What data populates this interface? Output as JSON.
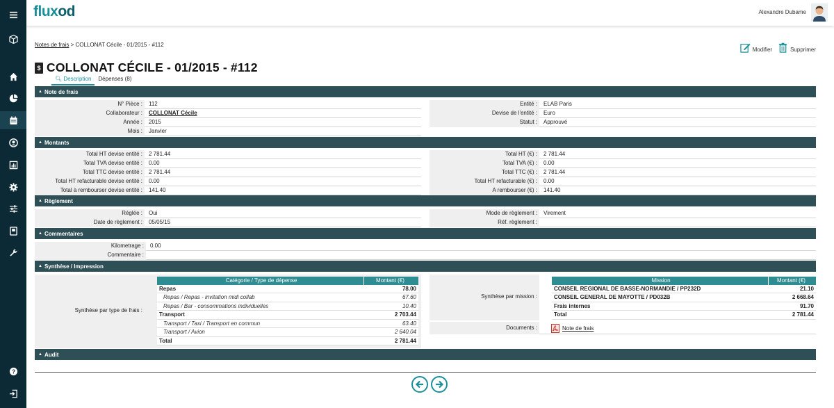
{
  "app": {
    "logo_a": "flux",
    "logo_b": "od",
    "user_name": "Alexandre Dubame"
  },
  "breadcrumb": {
    "link": "Notes de frais",
    "sep": " > ",
    "current": "COLLONAT Cécile - 01/2015 - #112"
  },
  "actions": {
    "edit": "Modifier",
    "delete": "Supprimer"
  },
  "title": "COLLONAT CÉCILE - 01/2015 - #112",
  "tabs": [
    {
      "label": "Description"
    },
    {
      "label": "Dépenses (8)"
    }
  ],
  "sections": {
    "note": "Note de frais",
    "montants": "Montants",
    "reglement": "Règlement",
    "commentaires": "Commentaires",
    "synthese": "Synthèse / Impression",
    "audit": "Audit"
  },
  "note": {
    "left": [
      {
        "label": "N° Pièce :",
        "value": "112"
      },
      {
        "label": "Collaborateur :",
        "value": "COLLONAT Cécile"
      },
      {
        "label": "Année :",
        "value": "2015"
      },
      {
        "label": "Mois :",
        "value": "Janvier"
      }
    ],
    "right": [
      {
        "label": "Entité :",
        "value": "ELAB Paris"
      },
      {
        "label": "Devise de l'entité :",
        "value": "Euro"
      },
      {
        "label": "Statut :",
        "value": "Approuvé"
      }
    ]
  },
  "montants": {
    "left": [
      {
        "label": "Total HT devise entité :",
        "value": "2 781.44"
      },
      {
        "label": "Total TVA devise entité :",
        "value": "0.00"
      },
      {
        "label": "Total TTC devise entité :",
        "value": "2 781.44"
      },
      {
        "label": "Total HT refacturable devise entité :",
        "value": "0.00"
      },
      {
        "label": "Total à rembourser devise entité :",
        "value": "141.40"
      }
    ],
    "right": [
      {
        "label": "Total HT (€) :",
        "value": "2 781.44"
      },
      {
        "label": "Total TVA (€) :",
        "value": "0.00"
      },
      {
        "label": "Total TTC (€) :",
        "value": "2 781.44"
      },
      {
        "label": "Total HT refacturable (€) :",
        "value": "0.00"
      },
      {
        "label": "A rembourser (€) :",
        "value": "141.40"
      }
    ]
  },
  "reglement": {
    "left": [
      {
        "label": "Réglée :",
        "value": "Oui"
      },
      {
        "label": "Date de règlement :",
        "value": "05/05/15"
      }
    ],
    "right": [
      {
        "label": "Mode de règlement :",
        "value": "Virement"
      },
      {
        "label": "Réf. règlement :",
        "value": ""
      }
    ]
  },
  "commentaires": [
    {
      "label": "Kilometrage :",
      "value": "0.00"
    },
    {
      "label": "Commentaire :",
      "value": ""
    }
  ],
  "synthese": {
    "type_label": "Synthèse par type de frais :",
    "mission_label": "Synthèse par mission :",
    "documents_label": "Documents :",
    "document_link": "Note de frais",
    "type_table": {
      "headers": [
        "Catégorie / Type de dépense",
        "Montant (€)"
      ],
      "rows": [
        {
          "name": "Repas",
          "amount": "78.00",
          "style": "b"
        },
        {
          "name": "Repas / Repas - invitation midi collab",
          "amount": "67.60",
          "style": "i"
        },
        {
          "name": "Repas / Bar - consommations individuelles",
          "amount": "10.40",
          "style": "i"
        },
        {
          "name": "Transport",
          "amount": "2 703.44",
          "style": "b"
        },
        {
          "name": "Transport / Taxi / Transport en commun",
          "amount": "63.40",
          "style": "i"
        },
        {
          "name": "Transport / Avion",
          "amount": "2 640.04",
          "style": "i"
        },
        {
          "name": "Total",
          "amount": "2 781.44",
          "style": "b"
        }
      ]
    },
    "mission_table": {
      "headers": [
        "Mission",
        "Montant (€)"
      ],
      "rows": [
        {
          "name": "CONSEIL REGIONAL DE BASSE-NORMANDIE / PP232D",
          "amount": "21.10",
          "style": "b"
        },
        {
          "name": "CONSEIL GENERAL DE MAYOTTE / PD032B",
          "amount": "2 668.64",
          "style": "b"
        },
        {
          "name": "Frais internes",
          "amount": "91.70",
          "style": "b"
        },
        {
          "name": "Total",
          "amount": "2 781.44",
          "style": "b"
        }
      ]
    }
  },
  "colors": {
    "rail": "#0b2a36",
    "section": "#2d4f55",
    "accent": "#1a8f9a",
    "table_header": "#2e8d92"
  }
}
